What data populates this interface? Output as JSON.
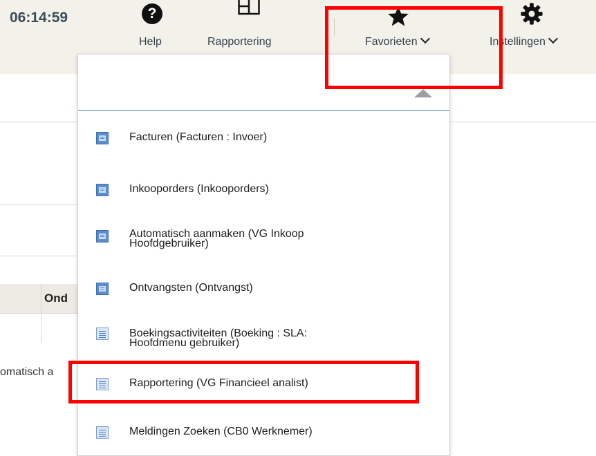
{
  "header": {
    "time": "06:14:59",
    "nav": [
      {
        "label": "Help",
        "icon": "help-icon"
      },
      {
        "label": "Rapportering",
        "icon": "report-icon"
      },
      {
        "label": "Favorieten",
        "icon": "star-icon"
      },
      {
        "label": "Instellingen",
        "icon": "gear-icon"
      }
    ]
  },
  "background": {
    "table_header": "Ond",
    "row_snippet": "omatisch a"
  },
  "dropdown": {
    "items": [
      {
        "line1": "Facturen (Facturen : Invoer)",
        "line2": "",
        "icon": "form-icon"
      },
      {
        "line1": "Inkooporders (Inkooporders)",
        "line2": "",
        "icon": "form-icon"
      },
      {
        "line1": "Automatisch aanmaken (VG Inkoop",
        "line2": "Hoofdgebruiker)",
        "icon": "form-icon"
      },
      {
        "line1": "Ontvangsten (Ontvangst)",
        "line2": "",
        "icon": "form-icon"
      },
      {
        "line1": "Boekingsactiviteiten (Boeking : SLA:",
        "line2": "Hoofdmenu gebruiker)",
        "icon": "document-icon"
      },
      {
        "line1": "Rapportering (VG Financieel analist)",
        "line2": "",
        "icon": "document-icon"
      },
      {
        "line1": "Meldingen Zoeken (CB0 Werknemer)",
        "line2": "",
        "icon": "document-icon"
      }
    ]
  },
  "colors": {
    "header_bg": "#f2f1ea",
    "highlight": "#ff0000",
    "accent_line": "#4a7fb0"
  }
}
